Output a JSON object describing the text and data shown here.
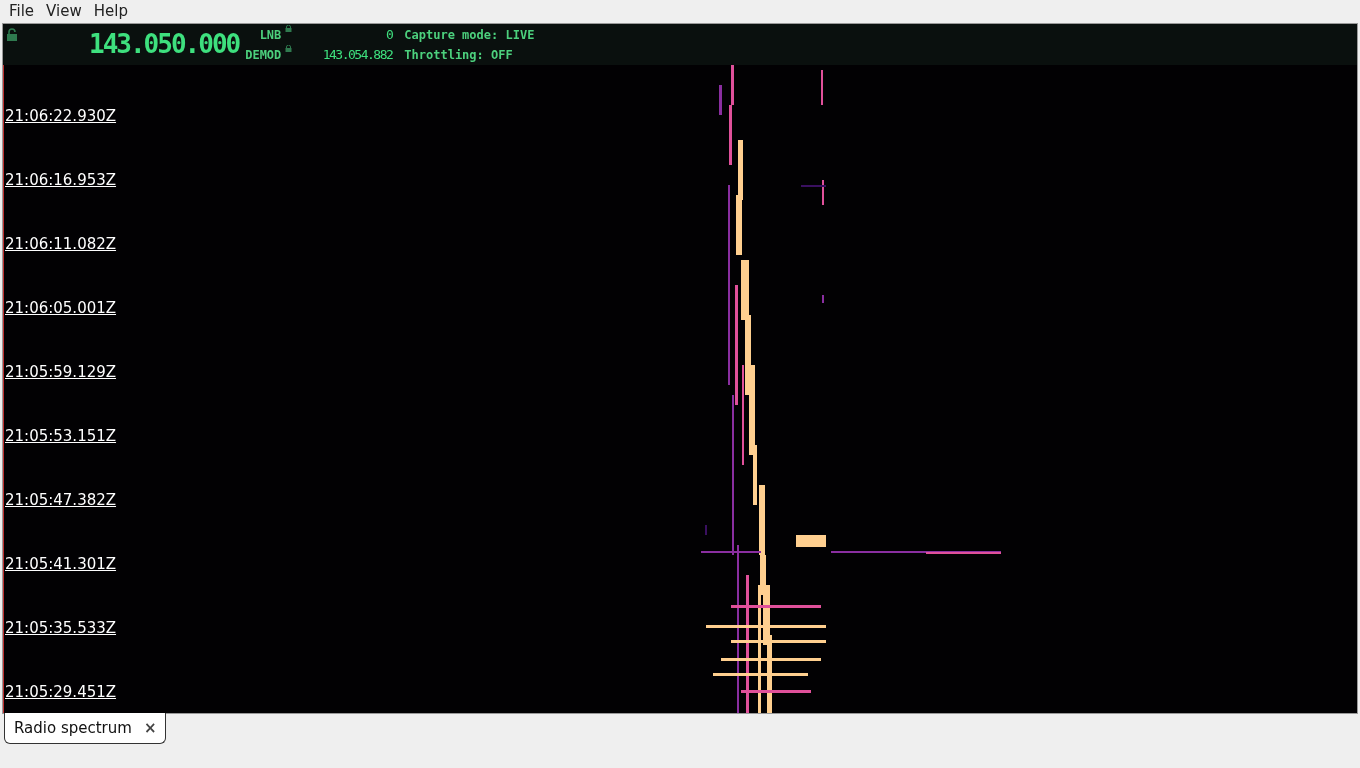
{
  "menu": [
    {
      "label": "File"
    },
    {
      "label": "View"
    },
    {
      "label": "Help"
    }
  ],
  "header": {
    "frequency": "143.050.000",
    "lnb_label": "LNB",
    "lnb_value": "0",
    "demod_label": "DEMOD",
    "demod_value": "143.054.882",
    "capture_mode": "Capture mode: LIVE",
    "throttling": "Throttling: OFF"
  },
  "timestamps": [
    "21:06:22.930Z",
    "21:06:16.953Z",
    "21:06:11.082Z",
    "21:06:05.001Z",
    "21:05:59.129Z",
    "21:05:53.151Z",
    "21:05:47.382Z",
    "21:05:41.301Z",
    "21:05:35.533Z",
    "21:05:29.451Z"
  ],
  "tabs": [
    {
      "label": "Radio spectrum",
      "close": "×",
      "selected": true
    }
  ]
}
